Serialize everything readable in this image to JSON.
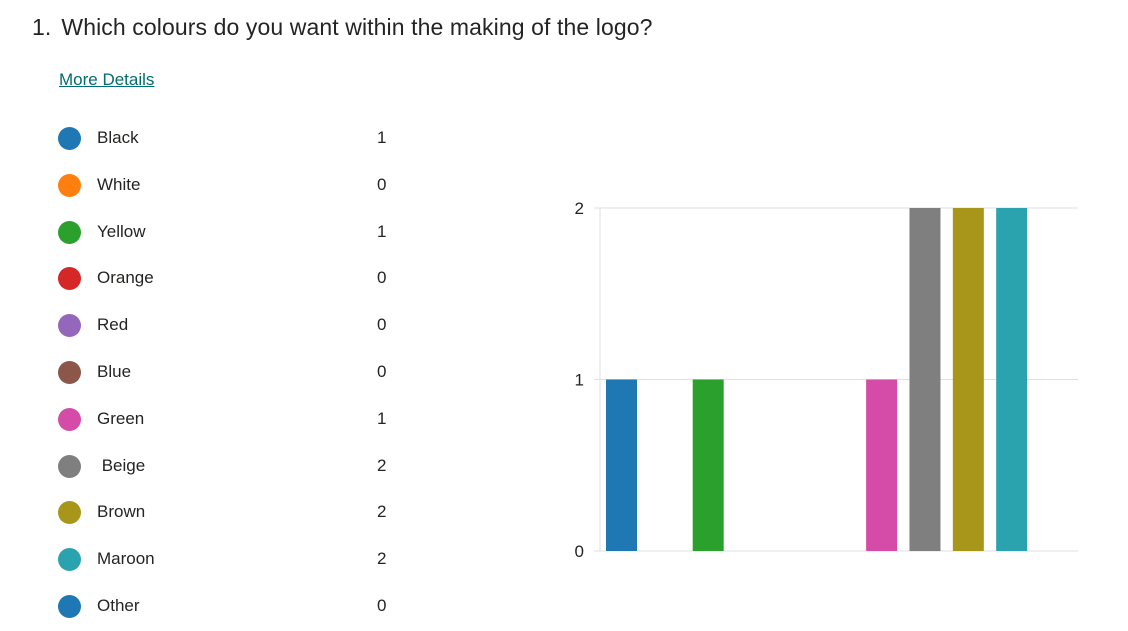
{
  "question": {
    "number": "1.",
    "text": "Which colours do you want within the making of the logo?"
  },
  "more_details_label": "More Details",
  "legend": [
    {
      "label": "Black",
      "count": "1",
      "color": "#1f77b4"
    },
    {
      "label": "White",
      "count": "0",
      "color": "#ff7f0e"
    },
    {
      "label": "Yellow",
      "count": "1",
      "color": "#2ca02c"
    },
    {
      "label": "Orange",
      "count": "0",
      "color": "#d62728"
    },
    {
      "label": "Red",
      "count": "0",
      "color": "#9467bd"
    },
    {
      "label": "Blue",
      "count": "0",
      "color": "#8c564b"
    },
    {
      "label": "Green",
      "count": "1",
      "color": "#d44ba8"
    },
    {
      "label": " Beige",
      "count": "2",
      "color": "#7f7f7f"
    },
    {
      "label": "Brown",
      "count": "2",
      "color": "#a8961a"
    },
    {
      "label": "Maroon",
      "count": "2",
      "color": "#2aa3ae"
    },
    {
      "label": "Other",
      "count": "0",
      "color": "#1f77b4"
    }
  ],
  "chart_data": {
    "type": "bar",
    "categories": [
      "Black",
      "White",
      "Yellow",
      "Orange",
      "Red",
      "Blue",
      "Green",
      "Beige",
      "Brown",
      "Maroon",
      "Other"
    ],
    "values": [
      1,
      0,
      1,
      0,
      0,
      0,
      1,
      2,
      2,
      2,
      0
    ],
    "colors": [
      "#1f77b4",
      "#ff7f0e",
      "#2ca02c",
      "#d62728",
      "#9467bd",
      "#8c564b",
      "#d44ba8",
      "#7f7f7f",
      "#a8961a",
      "#2aa3ae",
      "#1f77b4"
    ],
    "ylim": [
      0,
      2
    ],
    "yticks": [
      "0",
      "1",
      "2"
    ],
    "grid": true,
    "legend": "left"
  }
}
